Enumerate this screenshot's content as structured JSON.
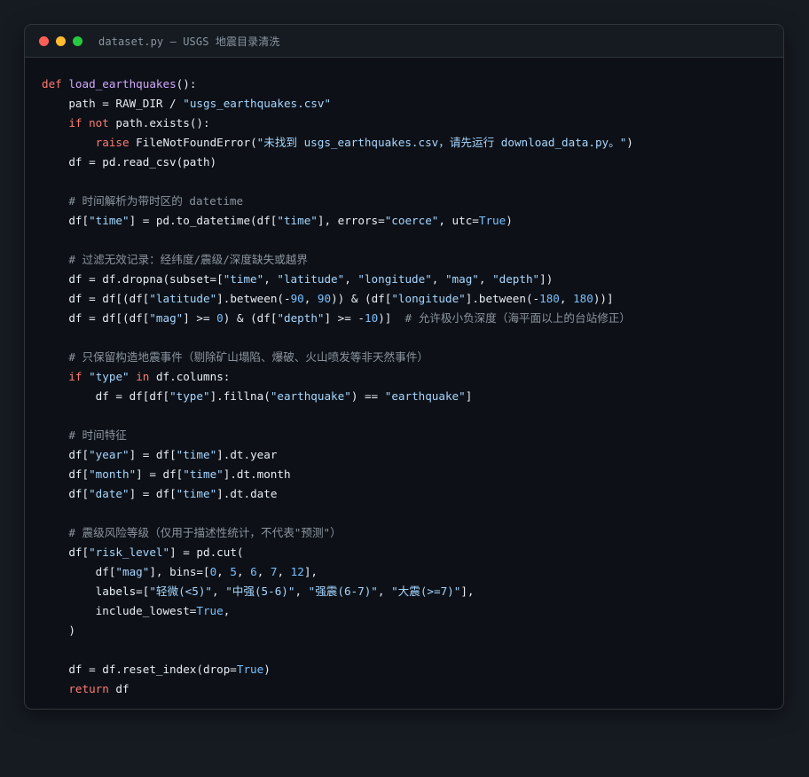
{
  "window": {
    "title": "dataset.py — USGS 地震目录清洗",
    "controls": [
      {
        "name": "close",
        "color": "#ff5f56"
      },
      {
        "name": "minimize",
        "color": "#ffbd2e"
      },
      {
        "name": "maximize",
        "color": "#27c93f"
      }
    ]
  },
  "colors": {
    "background": "#161b22",
    "editor": "#0d1117",
    "keyword": "#ff7b72",
    "function": "#d2a8ff",
    "string": "#a5d6ff",
    "number": "#79c0ff",
    "comment": "#8b949e",
    "text": "#e6edf3"
  },
  "code": [
    [
      {
        "t": "kw",
        "v": "def "
      },
      {
        "t": "fn",
        "v": "load_earthquakes"
      },
      {
        "t": "",
        "v": "():"
      }
    ],
    [
      {
        "t": "",
        "v": "    path = RAW_DIR / "
      },
      {
        "t": "str",
        "v": "\"usgs_earthquakes.csv\""
      }
    ],
    [
      {
        "t": "",
        "v": "    "
      },
      {
        "t": "kw",
        "v": "if not"
      },
      {
        "t": "",
        "v": " path.exists():"
      }
    ],
    [
      {
        "t": "",
        "v": "        "
      },
      {
        "t": "kw",
        "v": "raise"
      },
      {
        "t": "",
        "v": " FileNotFoundError("
      },
      {
        "t": "str",
        "v": "\"未找到 usgs_earthquakes.csv，请先运行 download_data.py。\""
      },
      {
        "t": "",
        "v": ")"
      }
    ],
    [
      {
        "t": "",
        "v": "    df = pd.read_csv(path)"
      }
    ],
    [],
    [
      {
        "t": "",
        "v": "    "
      },
      {
        "t": "cm",
        "v": "# 时间解析为带时区的 datetime"
      }
    ],
    [
      {
        "t": "",
        "v": "    df["
      },
      {
        "t": "str",
        "v": "\"time\""
      },
      {
        "t": "",
        "v": "] = pd.to_datetime(df["
      },
      {
        "t": "str",
        "v": "\"time\""
      },
      {
        "t": "",
        "v": "], errors="
      },
      {
        "t": "str",
        "v": "\"coerce\""
      },
      {
        "t": "",
        "v": ", utc="
      },
      {
        "t": "num",
        "v": "True"
      },
      {
        "t": "",
        "v": ")"
      }
    ],
    [],
    [
      {
        "t": "",
        "v": "    "
      },
      {
        "t": "cm",
        "v": "# 过滤无效记录：经纬度/震级/深度缺失或越界"
      }
    ],
    [
      {
        "t": "",
        "v": "    df = df.dropna(subset=["
      },
      {
        "t": "str",
        "v": "\"time\""
      },
      {
        "t": "",
        "v": ", "
      },
      {
        "t": "str",
        "v": "\"latitude\""
      },
      {
        "t": "",
        "v": ", "
      },
      {
        "t": "str",
        "v": "\"longitude\""
      },
      {
        "t": "",
        "v": ", "
      },
      {
        "t": "str",
        "v": "\"mag\""
      },
      {
        "t": "",
        "v": ", "
      },
      {
        "t": "str",
        "v": "\"depth\""
      },
      {
        "t": "",
        "v": "])"
      }
    ],
    [
      {
        "t": "",
        "v": "    df = df[(df["
      },
      {
        "t": "str",
        "v": "\"latitude\""
      },
      {
        "t": "",
        "v": "].between(-"
      },
      {
        "t": "num",
        "v": "90"
      },
      {
        "t": "",
        "v": ", "
      },
      {
        "t": "num",
        "v": "90"
      },
      {
        "t": "",
        "v": ")) & (df["
      },
      {
        "t": "str",
        "v": "\"longitude\""
      },
      {
        "t": "",
        "v": "].between(-"
      },
      {
        "t": "num",
        "v": "180"
      },
      {
        "t": "",
        "v": ", "
      },
      {
        "t": "num",
        "v": "180"
      },
      {
        "t": "",
        "v": "))]"
      }
    ],
    [
      {
        "t": "",
        "v": "    df = df[(df["
      },
      {
        "t": "str",
        "v": "\"mag\""
      },
      {
        "t": "",
        "v": "] >= "
      },
      {
        "t": "num",
        "v": "0"
      },
      {
        "t": "",
        "v": ") & (df["
      },
      {
        "t": "str",
        "v": "\"depth\""
      },
      {
        "t": "",
        "v": "] >= -"
      },
      {
        "t": "num",
        "v": "10"
      },
      {
        "t": "",
        "v": ")]  "
      },
      {
        "t": "cm",
        "v": "# 允许极小负深度（海平面以上的台站修正）"
      }
    ],
    [],
    [
      {
        "t": "",
        "v": "    "
      },
      {
        "t": "cm",
        "v": "# 只保留构造地震事件（剔除矿山塌陷、爆破、火山喷发等非天然事件）"
      }
    ],
    [
      {
        "t": "",
        "v": "    "
      },
      {
        "t": "kw",
        "v": "if"
      },
      {
        "t": "",
        "v": " "
      },
      {
        "t": "str",
        "v": "\"type\""
      },
      {
        "t": "",
        "v": " "
      },
      {
        "t": "kw",
        "v": "in"
      },
      {
        "t": "",
        "v": " df.columns:"
      }
    ],
    [
      {
        "t": "",
        "v": "        df = df[df["
      },
      {
        "t": "str",
        "v": "\"type\""
      },
      {
        "t": "",
        "v": "].fillna("
      },
      {
        "t": "str",
        "v": "\"earthquake\""
      },
      {
        "t": "",
        "v": ") == "
      },
      {
        "t": "str",
        "v": "\"earthquake\""
      },
      {
        "t": "",
        "v": "]"
      }
    ],
    [],
    [
      {
        "t": "",
        "v": "    "
      },
      {
        "t": "cm",
        "v": "# 时间特征"
      }
    ],
    [
      {
        "t": "",
        "v": "    df["
      },
      {
        "t": "str",
        "v": "\"year\""
      },
      {
        "t": "",
        "v": "] = df["
      },
      {
        "t": "str",
        "v": "\"time\""
      },
      {
        "t": "",
        "v": "].dt.year"
      }
    ],
    [
      {
        "t": "",
        "v": "    df["
      },
      {
        "t": "str",
        "v": "\"month\""
      },
      {
        "t": "",
        "v": "] = df["
      },
      {
        "t": "str",
        "v": "\"time\""
      },
      {
        "t": "",
        "v": "].dt.month"
      }
    ],
    [
      {
        "t": "",
        "v": "    df["
      },
      {
        "t": "str",
        "v": "\"date\""
      },
      {
        "t": "",
        "v": "] = df["
      },
      {
        "t": "str",
        "v": "\"time\""
      },
      {
        "t": "",
        "v": "].dt.date"
      }
    ],
    [],
    [
      {
        "t": "",
        "v": "    "
      },
      {
        "t": "cm",
        "v": "# 震级风险等级（仅用于描述性统计，不代表\"预测\"）"
      }
    ],
    [
      {
        "t": "",
        "v": "    df["
      },
      {
        "t": "str",
        "v": "\"risk_level\""
      },
      {
        "t": "",
        "v": "] = pd.cut("
      }
    ],
    [
      {
        "t": "",
        "v": "        df["
      },
      {
        "t": "str",
        "v": "\"mag\""
      },
      {
        "t": "",
        "v": "], bins=["
      },
      {
        "t": "num",
        "v": "0"
      },
      {
        "t": "",
        "v": ", "
      },
      {
        "t": "num",
        "v": "5"
      },
      {
        "t": "",
        "v": ", "
      },
      {
        "t": "num",
        "v": "6"
      },
      {
        "t": "",
        "v": ", "
      },
      {
        "t": "num",
        "v": "7"
      },
      {
        "t": "",
        "v": ", "
      },
      {
        "t": "num",
        "v": "12"
      },
      {
        "t": "",
        "v": "],"
      }
    ],
    [
      {
        "t": "",
        "v": "        labels=["
      },
      {
        "t": "str",
        "v": "\"轻微(<5)\""
      },
      {
        "t": "",
        "v": ", "
      },
      {
        "t": "str",
        "v": "\"中强(5-6)\""
      },
      {
        "t": "",
        "v": ", "
      },
      {
        "t": "str",
        "v": "\"强震(6-7)\""
      },
      {
        "t": "",
        "v": ", "
      },
      {
        "t": "str",
        "v": "\"大震(>=7)\""
      },
      {
        "t": "",
        "v": "],"
      }
    ],
    [
      {
        "t": "",
        "v": "        include_lowest="
      },
      {
        "t": "num",
        "v": "True"
      },
      {
        "t": "",
        "v": ","
      }
    ],
    [
      {
        "t": "",
        "v": "    )"
      }
    ],
    [],
    [
      {
        "t": "",
        "v": "    df = df.reset_index(drop="
      },
      {
        "t": "num",
        "v": "True"
      },
      {
        "t": "",
        "v": ")"
      }
    ],
    [
      {
        "t": "",
        "v": "    "
      },
      {
        "t": "kw",
        "v": "return"
      },
      {
        "t": "",
        "v": " df"
      }
    ]
  ]
}
